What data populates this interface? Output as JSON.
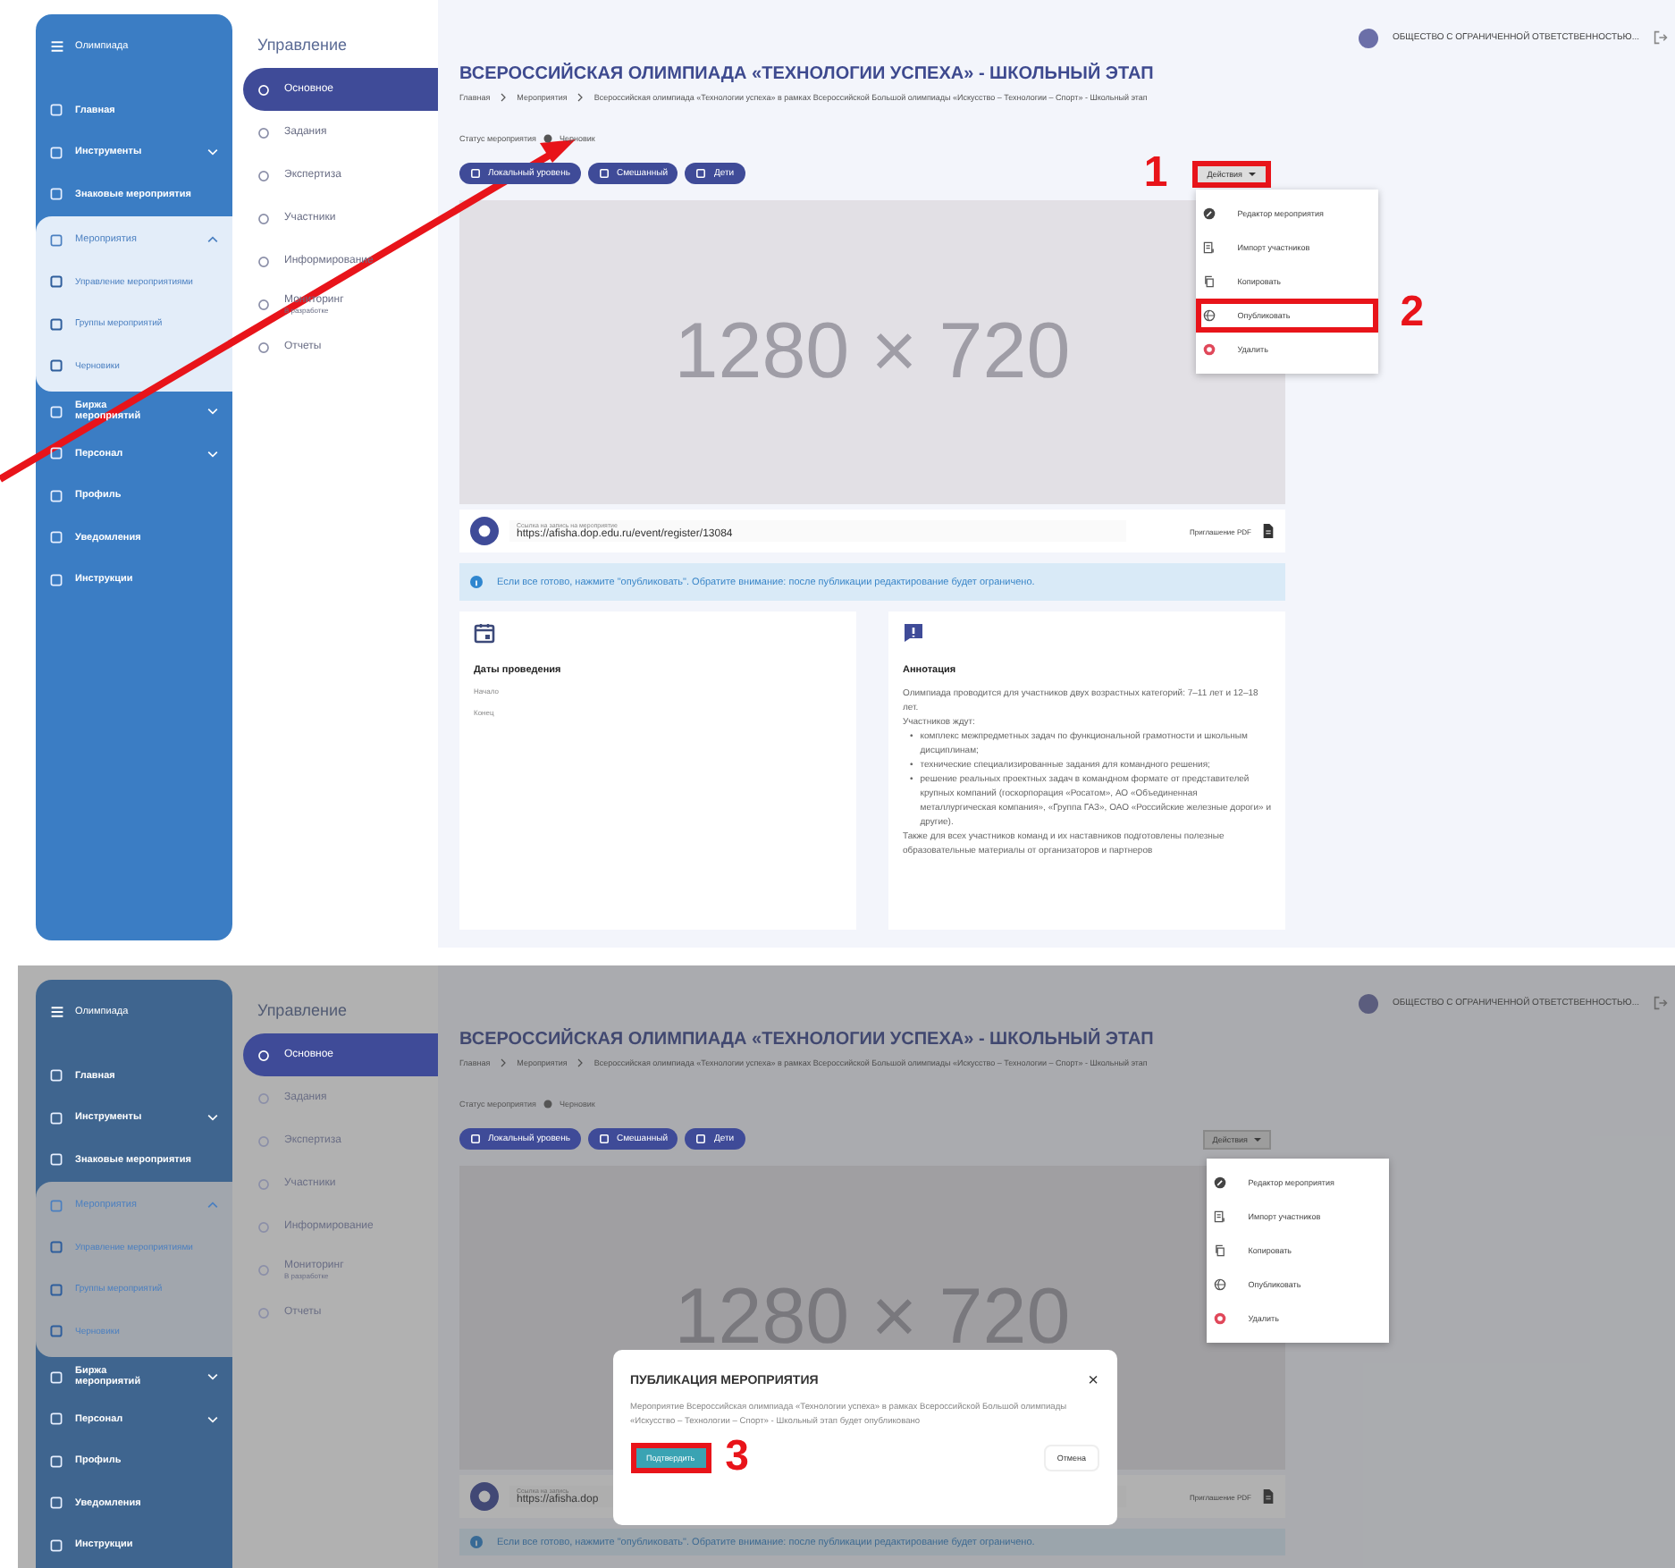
{
  "screens": [
    {
      "pointer_arrow": true,
      "sidebar": {
        "title": "Олимпиада",
        "items": [
          {
            "label": "Главная"
          },
          {
            "label": "Инструменты",
            "expanded": false
          },
          {
            "label": "Знаковые мероприятия"
          },
          {
            "label": "Мероприятия",
            "expanded": true,
            "children": [
              {
                "label": "Управление мероприятиями"
              },
              {
                "label": "Группы мероприятий"
              },
              {
                "label": "Черновики"
              }
            ]
          },
          {
            "label": "Биржа мероприятий",
            "expanded": false
          },
          {
            "label": "Персонал",
            "expanded": false
          },
          {
            "label": "Профиль"
          },
          {
            "label": "Уведомления"
          },
          {
            "label": "Инструкции"
          }
        ]
      },
      "subnav": {
        "heading": "Управление",
        "items": [
          {
            "label": "Основное",
            "selected": true
          },
          {
            "label": "Задания",
            "selected": false
          },
          {
            "label": "Экспертиза",
            "selected": false
          },
          {
            "label": "Участники",
            "selected": false
          },
          {
            "label": "Информирование",
            "selected": false
          },
          {
            "label": "Мониторинг",
            "note": "В разработке",
            "selected": false
          },
          {
            "label": "Отчеты",
            "selected": false
          }
        ]
      },
      "user": {
        "name": "ОБЩЕСТВО С ОГРАНИЧЕННОЙ ОТВЕТСТВЕННОСТЬЮ..."
      },
      "title": "ВСЕРОССИЙСКАЯ ОЛИМПИАДА «ТЕХНОЛОГИИ УСПЕХА» - ШКОЛЬНЫЙ ЭТАП",
      "breadcrumbs": [
        "Главная",
        "Мероприятия",
        "Всероссийская олимпиада «Технологии успеха» в рамках Всероссийской Большой олимпиады «Искусство – Технологии – Спорт» - Школьный этап"
      ],
      "status": {
        "label": "Статус мероприятия",
        "value": "Черновик"
      },
      "chips": [
        "Локальный уровень",
        "Смешанный",
        "Дети"
      ],
      "actions": {
        "label": "Действия",
        "highlighted": true,
        "step": "1"
      },
      "menu": [
        {
          "kind": "edit",
          "label": "Редактор мероприятия",
          "highlighted": false
        },
        {
          "kind": "import",
          "label": "Импорт участников",
          "highlighted": false
        },
        {
          "kind": "copy",
          "label": "Копировать",
          "highlighted": false
        },
        {
          "kind": "publish",
          "label": "Опубликовать",
          "highlighted": true,
          "step": "2"
        },
        {
          "kind": "delete",
          "label": "Удалить",
          "highlighted": false
        }
      ],
      "image_text": "1280 × 720",
      "link": {
        "label": "Ссылка на запись на мероприятие",
        "value": "https://afisha.dop.edu.ru/event/register/13084",
        "pdf": "Приглашение PDF"
      },
      "alert": "Если все готово, нажмите \"опубликовать\". Обратите внимание: после публикации редактирование будет ограничено.",
      "cards": {
        "dates": {
          "title": "Даты проведения",
          "start": "Начало",
          "end": "Конец"
        },
        "annotation": {
          "title": "Аннотация",
          "bullet": "•",
          "intro": "Олимпиада проводится для участников двух возрастных категорий: 7–11 лет и 12–18 лет.",
          "lead": "Участников ждут:",
          "bullets": [
            "комплекс межпредметных задач по функциональной грамотности и школьным дисциплинам;",
            "технические специализированные задания для командного решения;",
            "решение реальных проектных задач в командном формате от представителей крупных компаний (госкорпорация «Росатом», АО «Объединенная металлургическая компания», «Группа ГАЗ», ОАО «Российские железные дороги» и другие)."
          ],
          "outro": "Также для всех участников команд и их наставников подготовлены полезные образовательные материалы от организаторов и партнеров"
        }
      }
    },
    {
      "sidebar": {
        "title": "Олимпиада",
        "items": [
          {
            "label": "Главная"
          },
          {
            "label": "Инструменты",
            "expanded": false
          },
          {
            "label": "Знаковые мероприятия"
          },
          {
            "label": "Мероприятия",
            "expanded": true,
            "children": [
              {
                "label": "Управление мероприятиями"
              },
              {
                "label": "Группы мероприятий"
              },
              {
                "label": "Черновики"
              }
            ]
          },
          {
            "label": "Биржа мероприятий",
            "expanded": false
          },
          {
            "label": "Персонал",
            "expanded": false
          },
          {
            "label": "Профиль"
          },
          {
            "label": "Уведомления"
          },
          {
            "label": "Инструкции"
          }
        ]
      },
      "subnav": {
        "heading": "Управление",
        "items": [
          {
            "label": "Основное",
            "selected": true
          },
          {
            "label": "Задания",
            "selected": false
          },
          {
            "label": "Экспертиза",
            "selected": false
          },
          {
            "label": "Участники",
            "selected": false
          },
          {
            "label": "Информирование",
            "selected": false
          },
          {
            "label": "Мониторинг",
            "note": "В разработке",
            "selected": false
          },
          {
            "label": "Отчеты",
            "selected": false
          }
        ]
      },
      "user": {
        "name": "ОБЩЕСТВО С ОГРАНИЧЕННОЙ ОТВЕТСТВЕННОСТЬЮ..."
      },
      "title": "ВСЕРОССИЙСКАЯ ОЛИМПИАДА «ТЕХНОЛОГИИ УСПЕХА» - ШКОЛЬНЫЙ ЭТАП",
      "breadcrumbs": [
        "Главная",
        "Мероприятия",
        "Всероссийская олимпиада «Технологии успеха» в рамках Всероссийской Большой олимпиады «Искусство – Технологии – Спорт» - Школьный этап"
      ],
      "status": {
        "label": "Статус мероприятия",
        "value": "Черновик"
      },
      "chips": [
        "Локальный уровень",
        "Смешанный",
        "Дети"
      ],
      "actions": {
        "label": "Действия",
        "highlighted": false
      },
      "menu": [
        {
          "kind": "edit",
          "label": "Редактор мероприятия",
          "highlighted": false
        },
        {
          "kind": "import",
          "label": "Импорт участников",
          "highlighted": false
        },
        {
          "kind": "copy",
          "label": "Копировать",
          "highlighted": false
        },
        {
          "kind": "publish",
          "label": "Опубликовать",
          "highlighted": false
        },
        {
          "kind": "delete",
          "label": "Удалить",
          "highlighted": false
        }
      ],
      "image_text": "1280 × 720",
      "link": {
        "label": "Ссылка на запись",
        "value": "https://afisha.dop",
        "pdf": "Приглашение PDF"
      },
      "alert": "Если все готово, нажмите \"опубликовать\". Обратите внимание: после публикации редактирование будет ограничено.",
      "modal": {
        "title": "ПУБЛИКАЦИЯ МЕРОПРИЯТИЯ",
        "close": "×",
        "text": "Мероприятие Всероссийская олимпиада «Технологии успеха» в рамках Всероссийской Большой олимпиады «Искусство – Технологии – Спорт» - Школьный этап будет опубликовано",
        "confirm": {
          "label": "Подтвердить",
          "highlighted": true,
          "step": "3"
        },
        "cancel": "Отмена"
      }
    }
  ]
}
